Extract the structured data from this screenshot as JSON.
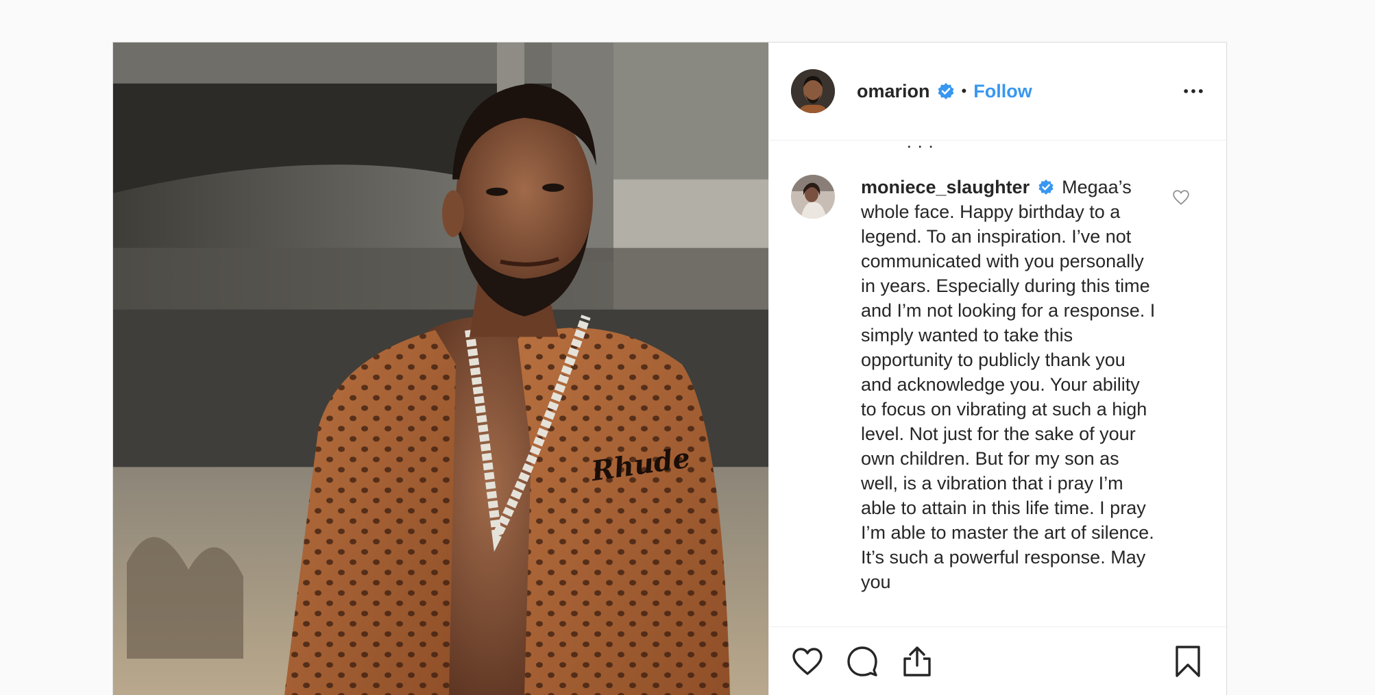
{
  "post": {
    "author": {
      "username": "omarion",
      "follow_label": "Follow",
      "separator": "•",
      "more_label": "•••"
    },
    "clipped_line": "·  ·  ·",
    "comment": {
      "username": "moniece_slaughter",
      "text": "Megaa’s whole face. Happy birthday to a legend. To an inspiration. I’ve not communicated with you personally in years. Especially during this time and I’m not looking for a response. I simply wanted to take this opportunity to publicly thank you and acknowledge you. Your ability to focus on vibrating at such a high level. Not just for the sake of your own children. But for my son as well, is a vibration that i pray I’m able to attain in this life time. I pray I’m able to master the art of silence. It’s such a powerful response. May you"
    },
    "photo": {
      "shirt_text": "Rhude"
    },
    "actions": [
      "like-icon",
      "comment-icon",
      "share-icon",
      "save-icon"
    ]
  },
  "colors": {
    "link_blue": "#3897f0",
    "verified_blue": "#3897f0",
    "text": "#262626",
    "border": "#dbdbdb"
  }
}
